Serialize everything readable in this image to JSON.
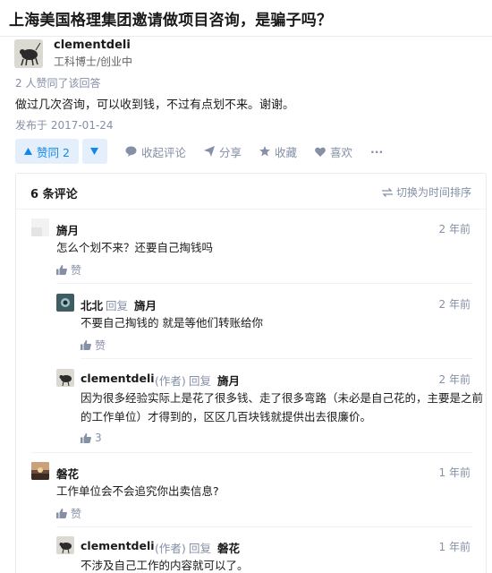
{
  "question": {
    "title": "上海美国格理集团邀请做项目咨询，是骗子吗？"
  },
  "answer": {
    "author_name": "clementdeli",
    "author_bio": "工科博士/创业中",
    "vote_info": "2 人赞同了该回答",
    "content": "做过几次咨询，可以收到钱，不过有点划不来。谢谢。",
    "publish_date": "发布于 2017-01-24"
  },
  "actions": {
    "vote_up_label": "赞同 2",
    "comment_label": "收起评论",
    "share_label": "分享",
    "collect_label": "收藏",
    "like_label": "喜欢",
    "more_label": "···",
    "accent_color": "#0f88eb"
  },
  "comments": {
    "count_label": "6 条评论",
    "sort_label": "切换为时间排序",
    "items": [
      {
        "name": "旖月",
        "time": "2 年前",
        "text": "怎么个划不来？还要自己掏钱吗",
        "like": "赞"
      },
      {
        "name": "北北",
        "reply_word": "回复",
        "reply_to": "旖月",
        "time": "2 年前",
        "text": "不要自己掏钱的 就是等他们转账给你",
        "like": "赞"
      },
      {
        "name": "clementdeli",
        "author_tag": "(作者)",
        "reply_word": "回复",
        "reply_to": "旖月",
        "time": "2 年前",
        "text_line1": "因为很多经验实际上是花了很多钱、走了很多弯路（未必是自己花的，主要是之前",
        "text_line2": "的工作单位）才得到的，区区几百块钱就提供出去很廉价。",
        "like": "3"
      },
      {
        "name": "磐花",
        "time": "1 年前",
        "text": "工作单位会不会追究你出卖信息?",
        "like": "赞"
      },
      {
        "name": "clementdeli",
        "author_tag": "(作者)",
        "reply_word": "回复",
        "reply_to": "磐花",
        "time": "1 年前",
        "text": "不涉及自己工作的内容就可以了。"
      }
    ]
  }
}
